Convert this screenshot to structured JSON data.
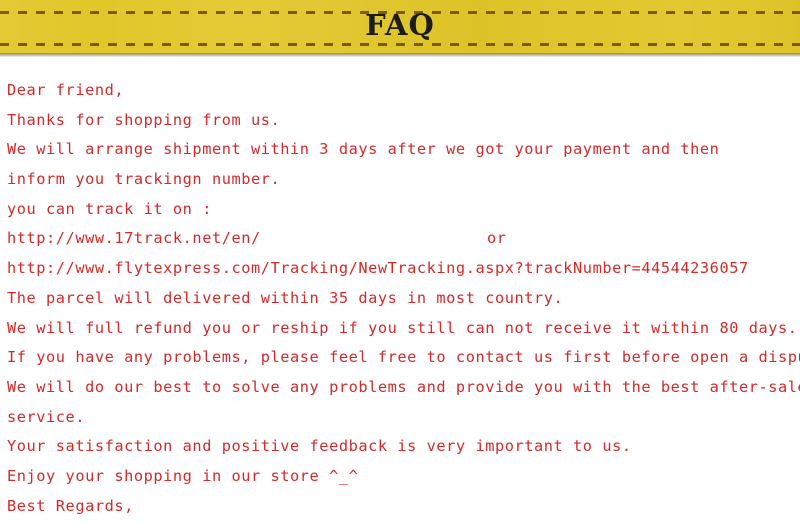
{
  "banner": {
    "title": "FAQ",
    "background_color": "#e2c729",
    "dash_color": "#7a5a14",
    "title_color": "#1c1c1c"
  },
  "body": {
    "text_color": "#d02b2b",
    "lines": [
      {
        "text": "Dear friend,"
      },
      {
        "text": "Thanks for shopping from us."
      },
      {
        "text": "We will arrange shipment within 3 days after we got your payment and then"
      },
      {
        "text": "inform you trackingn number."
      },
      {
        "text": "you can track it on :"
      },
      {
        "text": "http://www.17track.net/en/",
        "trailing": "or"
      },
      {
        "text": "http://www.flytexpress.com/Tracking/NewTracking.aspx?trackNumber=44544236057"
      },
      {
        "text": "The parcel will delivered within 35 days in most country."
      },
      {
        "text": "We will full refund you or reship if you still can not receive it within 80 days."
      },
      {
        "text": "If you have any problems, please feel free to contact us first before open a dispute."
      },
      {
        "text": "We will do our best to solve any problems and provide you with the best after-sale"
      },
      {
        "text": "service."
      },
      {
        "text": "Your satisfaction and positive feedback is very important to us."
      },
      {
        "text": "Enjoy your shopping in our store ^_^"
      },
      {
        "text": "Best Regards,"
      }
    ]
  }
}
